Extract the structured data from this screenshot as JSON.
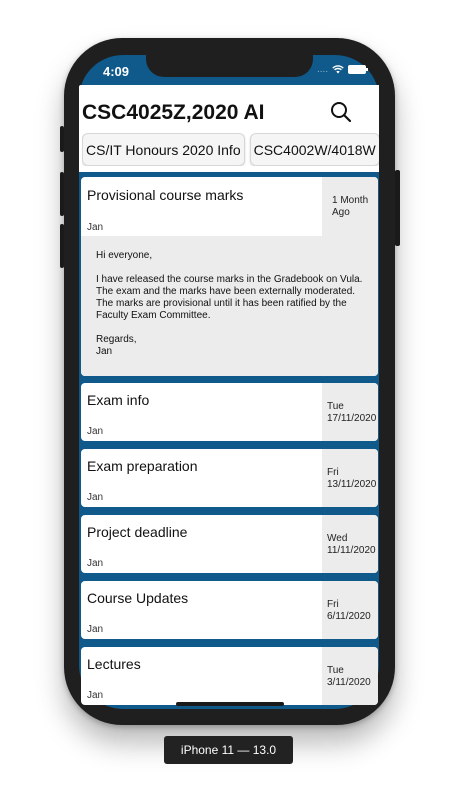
{
  "status": {
    "time": "4:09",
    "signal": "....",
    "wifi_icon": "wifi-icon",
    "battery_icon": "battery-icon"
  },
  "header": {
    "title": "CSC4025Z,2020 AI",
    "search_icon": "search-icon",
    "chips": [
      {
        "label": "CS/IT Honours 2020 Info"
      },
      {
        "label": "CSC4002W/4018W"
      }
    ]
  },
  "announcements": [
    {
      "title": "Provisional course marks",
      "author": "Jan",
      "date_line1": "1 Month",
      "date_line2": "Ago",
      "body": {
        "greeting": "Hi everyone,",
        "text": "I have released the course marks in the Gradebook on Vula. The exam and the marks have been externally moderated. The marks are provisional until it has been ratified by the Faculty Exam Committee.",
        "signoff_line1": "Regards,",
        "signoff_line2": "Jan"
      }
    },
    {
      "title": "Exam info",
      "author": "Jan",
      "date_line1": "Tue",
      "date_line2": "17/11/2020"
    },
    {
      "title": "Exam preparation",
      "author": "Jan",
      "date_line1": "Fri",
      "date_line2": "13/11/2020"
    },
    {
      "title": "Project deadline",
      "author": "Jan",
      "date_line1": "Wed",
      "date_line2": "11/11/2020"
    },
    {
      "title": "Course Updates",
      "author": "Jan",
      "date_line1": "Fri",
      "date_line2": "6/11/2020"
    },
    {
      "title": "Lectures",
      "author": "Jan",
      "date_line1": "Tue",
      "date_line2": "3/11/2020"
    }
  ],
  "device_label": "iPhone 11 — 13.0",
  "colors": {
    "accent": "#0f5a8a",
    "card_bg": "#ffffff",
    "date_bg": "#ececec"
  }
}
